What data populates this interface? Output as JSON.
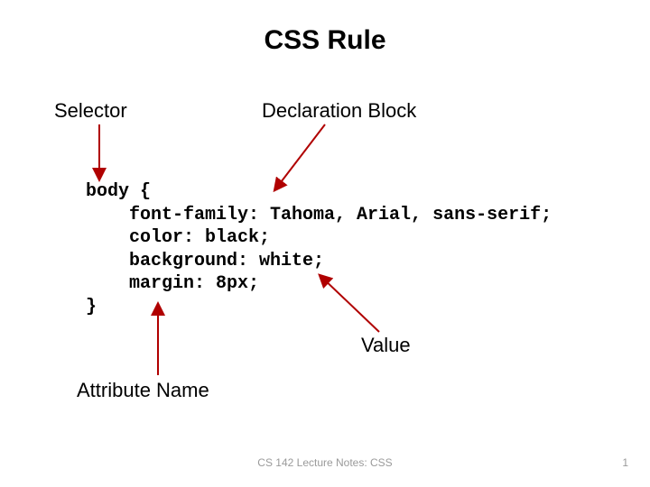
{
  "title": "CSS Rule",
  "labels": {
    "selector": "Selector",
    "declarationBlock": "Declaration Block",
    "value": "Value",
    "attributeName": "Attribute Name"
  },
  "code": {
    "l1": "body {",
    "l2": "    font-family: Tahoma, Arial, sans-serif;",
    "l3": "    color: black;",
    "l4": "    background: white;",
    "l5": "    margin: 8px;",
    "l6": "}"
  },
  "footer": "CS 142 Lecture Notes: CSS",
  "pageNumber": "1"
}
